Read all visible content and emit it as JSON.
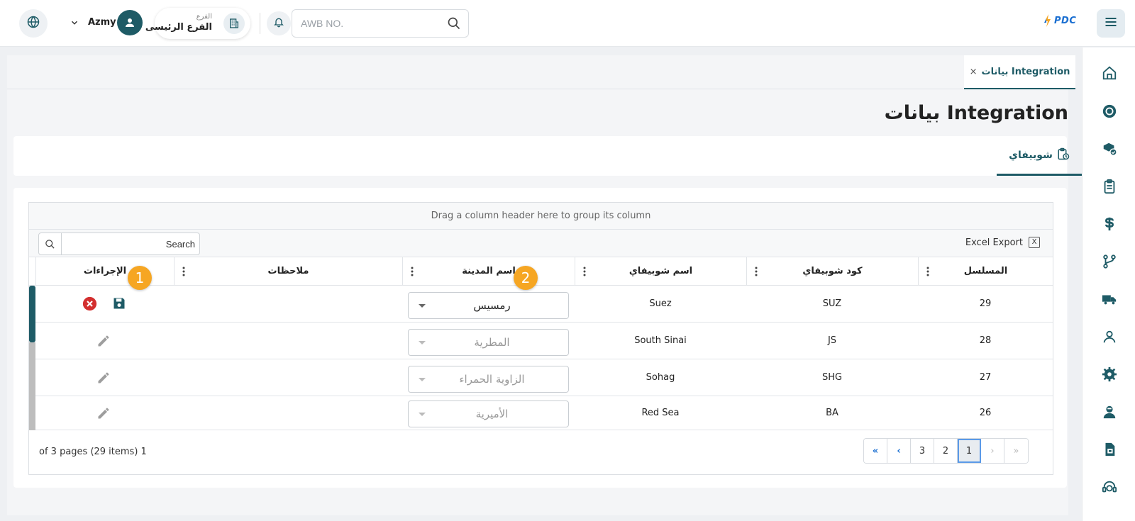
{
  "header": {
    "user_name": "Azmy",
    "branch_label": "الفرع",
    "branch_value": "الفرع الرئيسى",
    "awb_placeholder": "AWB NO.",
    "logo_text": "PDC"
  },
  "tabs": [
    {
      "label": "بيانات Integration",
      "close": "×"
    }
  ],
  "page_title": "بيانات Integration",
  "subtab_label": "شوبيفاي",
  "grid": {
    "group_hint": "Drag a column header here to group its column",
    "search_placeholder": "Search",
    "excel_export_label": "Excel Export",
    "excel_icon_text": "X",
    "columns": [
      "المسلسل",
      "كود شوبيفاي",
      "اسم شوبيفاي",
      "اسم المدينة",
      "ملاحظات",
      "الإجراءات"
    ],
    "rows": [
      {
        "serial": "29",
        "code": "SUZ",
        "name": "Suez",
        "city": "رمسيس",
        "notes": "",
        "editing": true
      },
      {
        "serial": "28",
        "code": "JS",
        "name": "South Sinai",
        "city": "المطرية",
        "notes": "",
        "editing": false
      },
      {
        "serial": "27",
        "code": "SHG",
        "name": "Sohag",
        "city": "الزاوية الحمراء",
        "notes": "",
        "editing": false
      },
      {
        "serial": "26",
        "code": "BA",
        "name": "Red Sea",
        "city": "الأميرية",
        "notes": "",
        "editing": false
      }
    ],
    "page_info": "of 3 pages (29 items) 1",
    "pager": [
      "«",
      "‹",
      "3",
      "2",
      "1",
      "›",
      "»"
    ]
  },
  "badges": [
    "1",
    "2"
  ],
  "colors": {
    "primary": "#1e5b66",
    "accent_badge": "#f6a623",
    "cancel": "#d32f2f",
    "logo_blue": "#1b6fd1"
  }
}
